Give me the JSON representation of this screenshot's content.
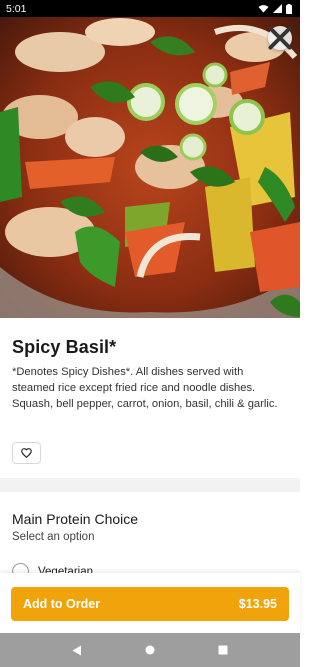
{
  "status_bar": {
    "time": "5:01"
  },
  "hero": {
    "image_alt": "",
    "close_icon": "close-icon"
  },
  "item": {
    "title": "Spicy Basil*",
    "description": "*Denotes Spicy Dishes*. All dishes served with steamed rice except fried rice and noodle dishes. Squash, bell pepper, carrot, onion, basil, chili & garlic.",
    "favorite_icon": "heart-outline-icon"
  },
  "protein_section": {
    "title": "Main Protein Choice",
    "subtitle": "Select an option",
    "options": [
      {
        "label": "Vegetarian",
        "selected": false
      }
    ]
  },
  "cart": {
    "add_label": "Add to Order",
    "price": "$13.95"
  },
  "colors": {
    "accent": "#f0a30a",
    "nav_bar": "#9e9e9e"
  }
}
